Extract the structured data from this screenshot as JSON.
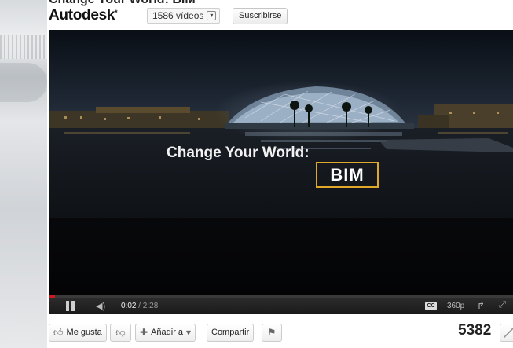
{
  "header": {
    "title_partial": "Change Your World: BIM",
    "channel_name": "Autodesk",
    "channel_mark": "*",
    "videos_count": "1586 vídeos",
    "subscribe_label": "Suscribirse"
  },
  "video": {
    "overlay_title": "Change Your World:",
    "overlay_box_text": "BIM",
    "progress_fraction": 0.014
  },
  "controls": {
    "current_time": "0:02",
    "duration": "/ 2:28",
    "cc_label": "CC",
    "quality": "360p"
  },
  "actions": {
    "like_label": "Me gusta",
    "add_to_label": "Añadir a",
    "share_label": "Compartir",
    "view_count": "5382"
  },
  "colors": {
    "progress": "#cc181e",
    "overlay_box": "#e0a82a"
  },
  "icons": [
    "thumbs-up-icon",
    "thumbs-down-icon",
    "plus-icon",
    "chevron-down-icon",
    "flag-icon",
    "pause-icon",
    "volume-icon",
    "cc-icon",
    "popout-icon",
    "fullscreen-icon",
    "stats-icon"
  ]
}
